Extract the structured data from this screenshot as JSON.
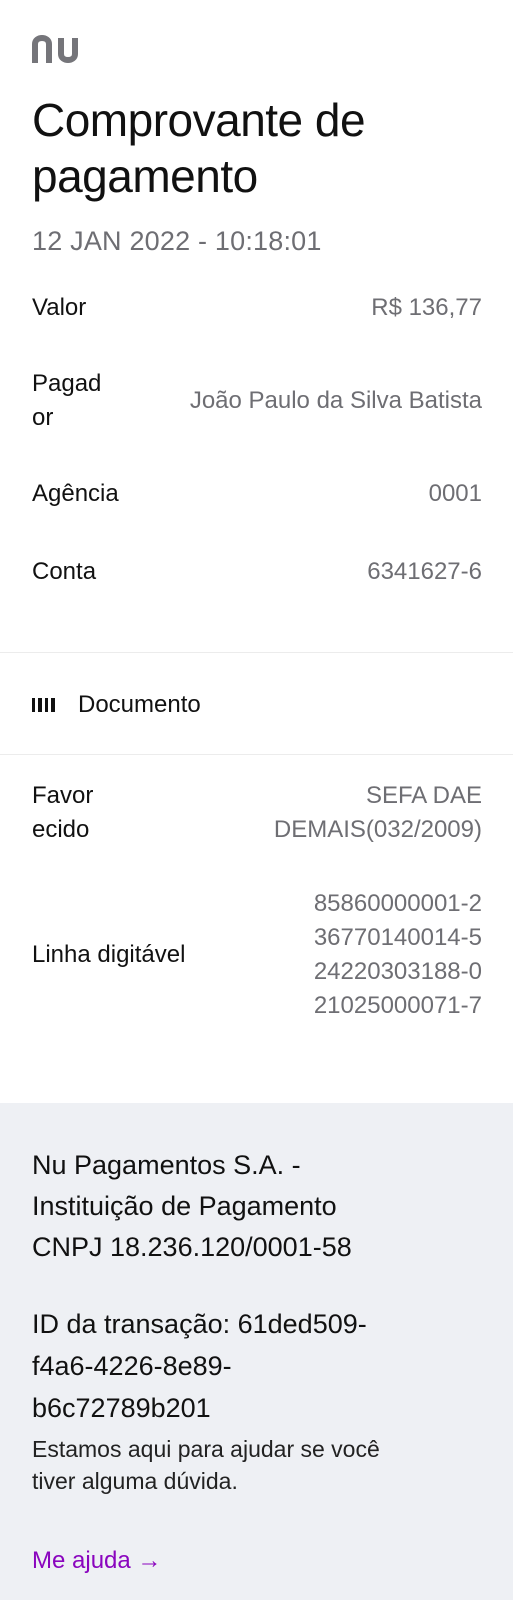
{
  "brand": {
    "logo_icon": "nu-logo-icon",
    "color": "#8a05be"
  },
  "header": {
    "title": "Comprovante de pagamento",
    "datetime": "12 JAN 2022 - 10:18:01"
  },
  "details": {
    "valor_label": "Valor",
    "valor_value": "R$ 136,77",
    "pagador_label_1": "Pagad",
    "pagador_label_2": "or",
    "pagador_value": "João Paulo da Silva Batista",
    "agencia_label": "Agência",
    "agencia_value": "0001",
    "conta_label": "Conta",
    "conta_value": "6341627-6"
  },
  "documento": {
    "icon": "barcode-icon",
    "heading": "Documento",
    "favorecido_label_1": "Favor",
    "favorecido_label_2": "ecido",
    "favorecido_value_1": "SEFA DAE",
    "favorecido_value_2": "DEMAIS(032/2009)",
    "linha_label": "Linha digitável",
    "linha_values": [
      "85860000001-2",
      "36770140014-5",
      "24220303188-0",
      "21025000071-7"
    ]
  },
  "footer": {
    "company_1": "Nu Pagamentos S.A. -",
    "company_2": "Instituição de Pagamento",
    "company_3": "CNPJ 18.236.120/0001-58",
    "txid_1": "ID da transação: 61ded509-",
    "txid_2": "f4a6-4226-8e89-",
    "txid_3": "b6c72789b201",
    "help_text_1": "Estamos aqui para ajudar se você",
    "help_text_2": "tiver alguma dúvida.",
    "help_link": "Me ajuda →"
  }
}
